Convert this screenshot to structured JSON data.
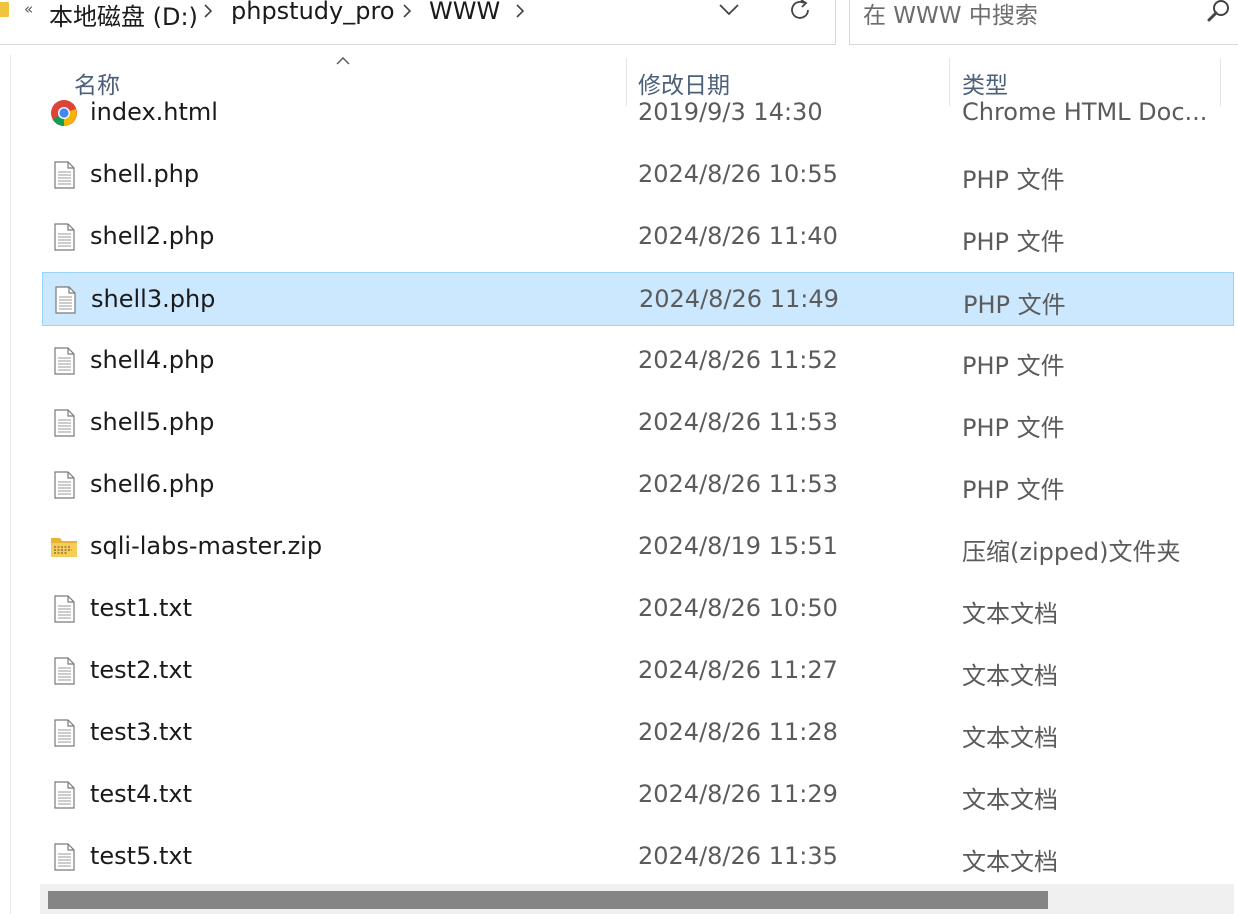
{
  "address_bar": {
    "overflow_glyph": "«",
    "crumbs": [
      "本地磁盘 (D:)",
      "phpstudy_pro",
      "WWW"
    ]
  },
  "search": {
    "placeholder": "在 WWW 中搜索"
  },
  "columns": {
    "name": "名称",
    "modified": "修改日期",
    "type": "类型"
  },
  "files": [
    {
      "name": "index.html",
      "modified": "2019/9/3 14:30",
      "type": "Chrome HTML Doc...",
      "icon": "chrome-icon"
    },
    {
      "name": "shell.php",
      "modified": "2024/8/26 10:55",
      "type": "PHP 文件",
      "icon": "document-icon"
    },
    {
      "name": "shell2.php",
      "modified": "2024/8/26 11:40",
      "type": "PHP 文件",
      "icon": "document-icon"
    },
    {
      "name": "shell3.php",
      "modified": "2024/8/26 11:49",
      "type": "PHP 文件",
      "icon": "document-icon",
      "selected": true
    },
    {
      "name": "shell4.php",
      "modified": "2024/8/26 11:52",
      "type": "PHP 文件",
      "icon": "document-icon"
    },
    {
      "name": "shell5.php",
      "modified": "2024/8/26 11:53",
      "type": "PHP 文件",
      "icon": "document-icon"
    },
    {
      "name": "shell6.php",
      "modified": "2024/8/26 11:53",
      "type": "PHP 文件",
      "icon": "document-icon"
    },
    {
      "name": "sqli-labs-master.zip",
      "modified": "2024/8/19 15:51",
      "type": "压缩(zipped)文件夹",
      "icon": "zip-folder-icon"
    },
    {
      "name": "test1.txt",
      "modified": "2024/8/26 10:50",
      "type": "文本文档",
      "icon": "document-icon"
    },
    {
      "name": "test2.txt",
      "modified": "2024/8/26 11:27",
      "type": "文本文档",
      "icon": "document-icon"
    },
    {
      "name": "test3.txt",
      "modified": "2024/8/26 11:28",
      "type": "文本文档",
      "icon": "document-icon"
    },
    {
      "name": "test4.txt",
      "modified": "2024/8/26 11:29",
      "type": "文本文档",
      "icon": "document-icon"
    },
    {
      "name": "test5.txt",
      "modified": "2024/8/26 11:35",
      "type": "文本文档",
      "icon": "document-icon"
    }
  ],
  "colors": {
    "selection_bg": "#cce8ff",
    "selection_border": "#99d1ff",
    "header_text": "#4c607a"
  }
}
